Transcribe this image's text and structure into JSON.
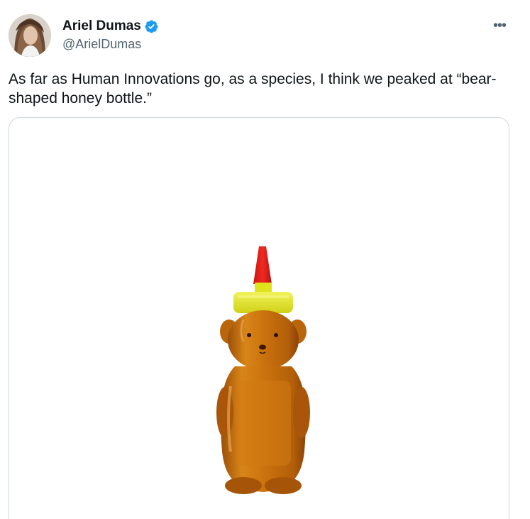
{
  "author": {
    "display_name": "Ariel Dumas",
    "handle": "@ArielDumas",
    "verified": true,
    "verified_color": "#1d9bf0",
    "avatar_icon": "profile-photo"
  },
  "menu": {
    "more_icon": "more-horizontal-icon",
    "more_label": "•••"
  },
  "tweet": {
    "text": "As far as Human Innovations go, as a species, I think we peaked at “bear-shaped honey bottle.”"
  },
  "media": {
    "subject": "bear-shaped-honey-bottle",
    "colors": {
      "tip": "#e8221c",
      "cap": "#e6ea1a",
      "honey": "#c7700f"
    }
  }
}
